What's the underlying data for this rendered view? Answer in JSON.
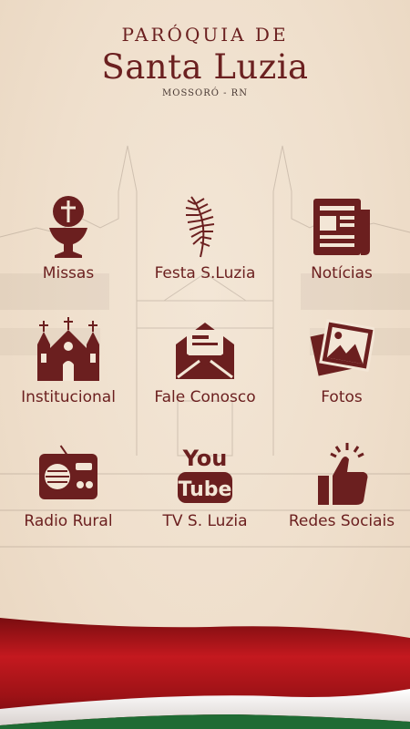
{
  "header": {
    "line1": "PARÓQUIA DE",
    "line2": "Santa Luzia",
    "line3": "MOSSORÓ - RN"
  },
  "menu": [
    {
      "label": "Missas",
      "icon": "chalice-icon"
    },
    {
      "label": "Festa S.Luzia",
      "icon": "palm-leaf-icon"
    },
    {
      "label": "Notícias",
      "icon": "newspaper-icon"
    },
    {
      "label": "Institucional",
      "icon": "church-icon"
    },
    {
      "label": "Fale Conosco",
      "icon": "envelope-icon"
    },
    {
      "label": "Fotos",
      "icon": "photos-icon"
    },
    {
      "label": "Radio Rural",
      "icon": "radio-icon"
    },
    {
      "label": "TV S. Luzia",
      "icon": "youtube-icon"
    },
    {
      "label": "Redes Sociais",
      "icon": "thumbs-up-icon"
    }
  ],
  "colors": {
    "accent": "#6b1f1f",
    "background": "#efdfcc",
    "flag_red": "#b3161b",
    "flag_green": "#1f6b34"
  }
}
